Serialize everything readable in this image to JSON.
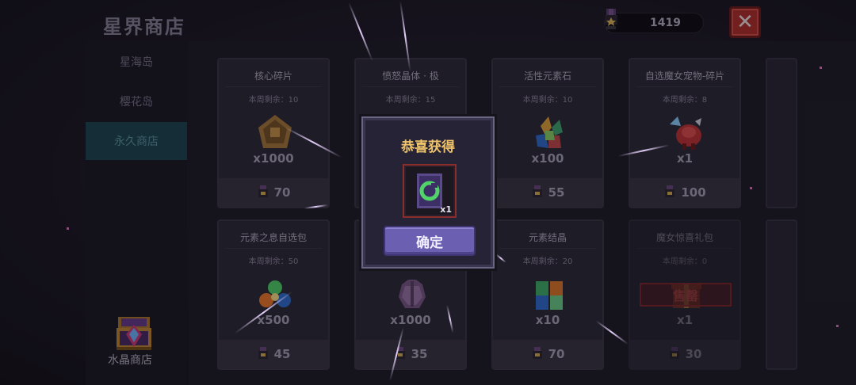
{
  "header": {
    "title": "星界商店",
    "currency_amount": "1419",
    "close_label": "✕"
  },
  "sidebar": {
    "tabs": [
      {
        "label": "星海岛",
        "active": false
      },
      {
        "label": "樱花岛",
        "active": false
      },
      {
        "label": "永久商店",
        "active": true
      }
    ],
    "crystal_shop_label": "水晶商店"
  },
  "shop": {
    "items": [
      {
        "name": "核心碎片",
        "remaining": "本周剩余：10",
        "quantity": "x1000",
        "price": "70",
        "icon": "core-fragment-icon"
      },
      {
        "name": "愤怒晶体 · 极",
        "remaining": "本周剩余：15",
        "quantity": "",
        "price": "",
        "icon": "rage-crystal-icon"
      },
      {
        "name": "活性元素石",
        "remaining": "本周剩余：10",
        "quantity": "x100",
        "price": "55",
        "icon": "element-stone-icon"
      },
      {
        "name": "自选魔女宠物-碎片",
        "remaining": "本周剩余：8",
        "quantity": "x1",
        "price": "100",
        "icon": "pet-fragment-icon"
      },
      {
        "name": "元素之息自选包",
        "remaining": "本周剩余：50",
        "quantity": "x500",
        "price": "45",
        "icon": "element-breath-pack-icon"
      },
      {
        "name": "",
        "remaining": "",
        "quantity": "x1000",
        "price": "35",
        "icon": "cloth-icon"
      },
      {
        "name": "元素结晶",
        "remaining": "本周剩余：20",
        "quantity": "x10",
        "price": "70",
        "icon": "element-crystal-icon"
      },
      {
        "name": "魔女惊喜礼包",
        "remaining": "本周剩余：0",
        "quantity": "x1",
        "price": "30",
        "icon": "surprise-gift-icon",
        "sold_out": "售罄"
      }
    ]
  },
  "modal": {
    "title": "恭喜获得",
    "reward_quantity": "x1",
    "reward_icon": "green-rune-card-icon",
    "confirm_label": "确定"
  },
  "colors": {
    "accent_purple": "#6b5fb1",
    "gold": "#f0c46b",
    "sold_out_red": "#b8302c",
    "active_tab": "#1c4650"
  }
}
